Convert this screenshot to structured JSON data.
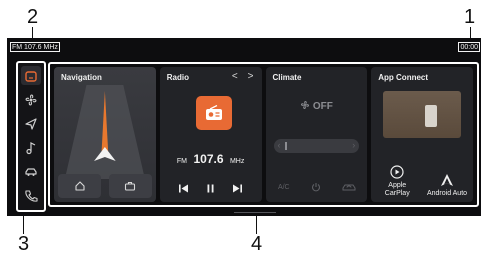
{
  "callouts": {
    "c1": "1",
    "c2": "2",
    "c3": "3",
    "c4": "4"
  },
  "status_bar": {
    "radio_info": "FM 107.6 MHz",
    "clock": "00:00"
  },
  "sidebar": {
    "items": [
      {
        "name": "home",
        "icon": "home-icon",
        "active": true
      },
      {
        "name": "climate",
        "icon": "fan-icon"
      },
      {
        "name": "navigation",
        "icon": "navigation-arrow-icon"
      },
      {
        "name": "media",
        "icon": "music-note-icon"
      },
      {
        "name": "vehicle",
        "icon": "car-icon"
      },
      {
        "name": "phone",
        "icon": "phone-icon"
      }
    ]
  },
  "navigation": {
    "title": "Navigation"
  },
  "radio": {
    "title": "Radio",
    "prev_arrow": "<",
    "next_arrow": ">",
    "band": "FM",
    "frequency": "107.6",
    "unit": "MHz"
  },
  "climate": {
    "title": "Climate",
    "state": "OFF",
    "ac_label": "A/C"
  },
  "app_connect": {
    "title": "App Connect",
    "carplay_label": "Apple CarPlay",
    "android_label": "Android Auto"
  },
  "colors": {
    "screen_bg": "#0d0d0f",
    "card_bg": "#222327",
    "radio_accent": "#e86a34",
    "route": "#e8782e",
    "frame_border": "#ffffff"
  }
}
